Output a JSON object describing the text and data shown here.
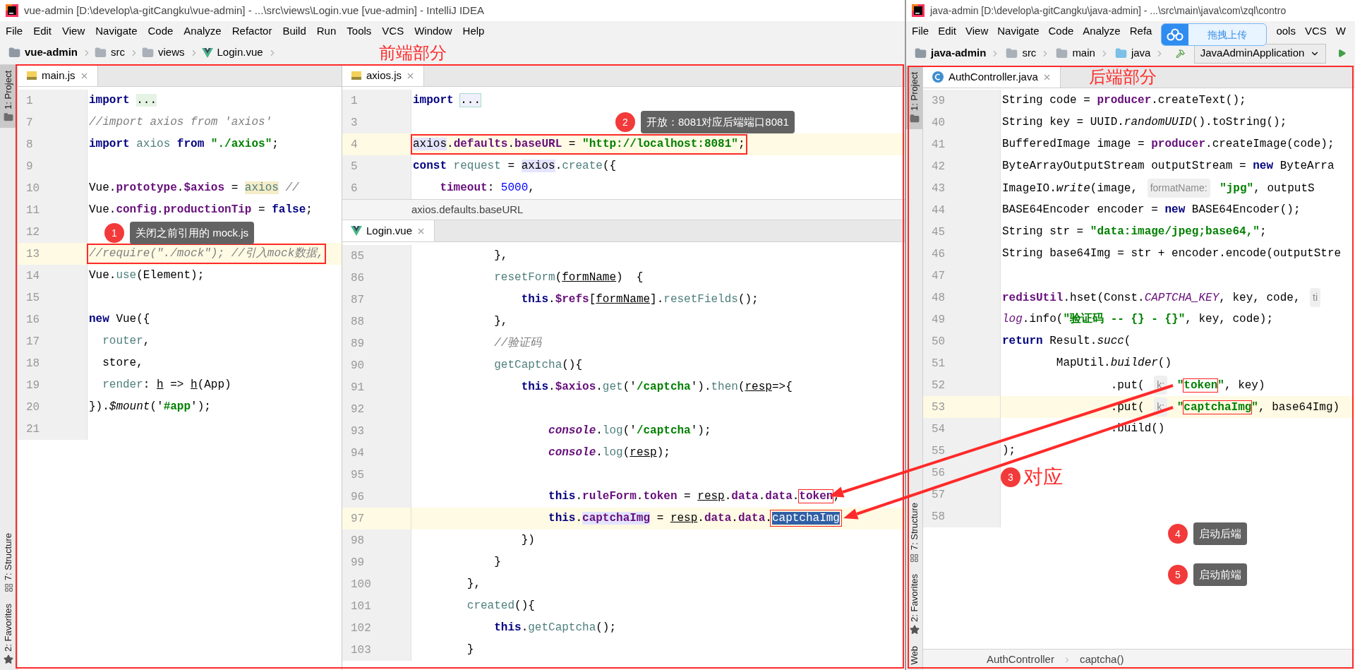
{
  "left_window": {
    "title": "vue-admin [D:\\develop\\a-gitCangku\\vue-admin] - ...\\src\\views\\Login.vue [vue-admin] - IntelliJ IDEA",
    "menu": [
      "File",
      "Edit",
      "View",
      "Navigate",
      "Code",
      "Analyze",
      "Refactor",
      "Build",
      "Run",
      "Tools",
      "VCS",
      "Window",
      "Help"
    ],
    "breadcrumb": [
      {
        "kind": "project",
        "label": "vue-admin"
      },
      {
        "kind": "folder",
        "label": "src"
      },
      {
        "kind": "folder",
        "label": "views"
      },
      {
        "kind": "vue",
        "label": "Login.vue"
      }
    ],
    "annotation_label": "前端部分",
    "tool_strip": [
      {
        "kind": "project",
        "label": "1: Project",
        "selected": true
      },
      {
        "kind": "structure",
        "label": "7: Structure",
        "selected": false
      },
      {
        "kind": "favorites",
        "label": "2: Favorites",
        "selected": false
      }
    ],
    "main_editor": {
      "tab": {
        "kind": "js",
        "label": "main.js"
      },
      "lines": [
        {
          "number": "1",
          "current": false,
          "boxed": false,
          "tokens": [
            {
              "kind": "kw",
              "text": "import "
            },
            {
              "kind": "fold",
              "text": "..."
            }
          ]
        },
        {
          "number": "7",
          "current": false,
          "boxed": false,
          "tokens": [
            {
              "kind": "cmt",
              "text": "//import axios from 'axios'"
            }
          ]
        },
        {
          "number": "8",
          "current": false,
          "boxed": false,
          "tokens": [
            {
              "kind": "kw",
              "text": "import "
            },
            {
              "kind": "fn",
              "text": "axios "
            },
            {
              "kind": "kw",
              "text": "from "
            },
            {
              "kind": "str",
              "text": "\"./axios\""
            },
            {
              "kind": "plain",
              "text": ";"
            }
          ]
        },
        {
          "number": "9",
          "current": false,
          "boxed": false
        },
        {
          "number": "10",
          "current": false,
          "boxed": false,
          "tokens": [
            {
              "kind": "plain",
              "text": "Vue."
            },
            {
              "kind": "fld",
              "text": "prototype"
            },
            {
              "kind": "plain",
              "text": "."
            },
            {
              "kind": "fld",
              "text": "$axios"
            },
            {
              "kind": "plain",
              "text": " = "
            },
            {
              "kind": "fn_mark",
              "text": "axios"
            },
            {
              "kind": "cmt",
              "text": " //"
            }
          ]
        },
        {
          "number": "11",
          "current": false,
          "boxed": false,
          "tokens": [
            {
              "kind": "plain",
              "text": "Vue."
            },
            {
              "kind": "fld",
              "text": "config"
            },
            {
              "kind": "plain",
              "text": "."
            },
            {
              "kind": "fld",
              "text": "productionTip"
            },
            {
              "kind": "plain",
              "text": " = "
            },
            {
              "kind": "kw",
              "text": "false"
            },
            {
              "kind": "plain",
              "text": ";"
            }
          ]
        },
        {
          "number": "12",
          "current": false,
          "boxed": false
        },
        {
          "number": "13",
          "current": true,
          "boxed": true,
          "tokens": [
            {
              "kind": "cmt",
              "text": "//require(\"./mock\"); //引入mock数据,"
            }
          ]
        },
        {
          "number": "14",
          "current": false,
          "boxed": false,
          "tokens": [
            {
              "kind": "plain",
              "text": "Vue."
            },
            {
              "kind": "fn",
              "text": "use"
            },
            {
              "kind": "plain",
              "text": "(Element);"
            }
          ]
        },
        {
          "number": "15",
          "current": false,
          "boxed": false
        },
        {
          "number": "16",
          "current": false,
          "boxed": false,
          "tokens": [
            {
              "kind": "kw",
              "text": "new"
            },
            {
              "kind": "plain",
              "text": " Vue({"
            }
          ]
        },
        {
          "number": "17",
          "current": false,
          "boxed": false,
          "tokens": [
            {
              "kind": "fn",
              "text": "  router"
            },
            {
              "kind": "plain",
              "text": ","
            }
          ]
        },
        {
          "number": "18",
          "current": false,
          "boxed": false,
          "tokens": [
            {
              "kind": "plain",
              "text": "  store,"
            }
          ]
        },
        {
          "number": "19",
          "current": false,
          "boxed": false,
          "tokens": [
            {
              "kind": "fn",
              "text": "  render"
            },
            {
              "kind": "plain",
              "text": ": "
            },
            {
              "kind": "und",
              "text": "h"
            },
            {
              "kind": "plain",
              "text": " => "
            },
            {
              "kind": "und",
              "text": "h"
            },
            {
              "kind": "plain",
              "text": "(App)"
            }
          ]
        },
        {
          "number": "20",
          "current": false,
          "boxed": false,
          "tokens": [
            {
              "kind": "plain",
              "text": "})."
            },
            {
              "kind": "ital",
              "text": "$mount"
            },
            {
              "kind": "plain",
              "text": "('"
            },
            {
              "kind": "str",
              "text": "#app"
            },
            {
              "kind": "plain",
              "text": "');"
            }
          ]
        },
        {
          "number": "21",
          "current": false,
          "boxed": false
        }
      ]
    },
    "axios_editor": {
      "tab": {
        "kind": "js",
        "label": "axios.js"
      },
      "lines": [
        {
          "number": "1",
          "current": false,
          "boxed": false,
          "tokens": [
            {
              "kind": "kw",
              "text": "import "
            },
            {
              "kind": "fold_box",
              "text": "..."
            }
          ]
        },
        {
          "number": "3",
          "current": false,
          "boxed": false
        },
        {
          "number": "4",
          "current": true,
          "boxed": true,
          "tokens": [
            {
              "kind": "plain_hl",
              "text": "axios"
            },
            {
              "kind": "plain",
              "text": "."
            },
            {
              "kind": "fld",
              "text": "defaults"
            },
            {
              "kind": "plain",
              "text": "."
            },
            {
              "kind": "fld",
              "text": "baseURL"
            },
            {
              "kind": "plain",
              "text": " = "
            },
            {
              "kind": "str",
              "text": "\"http://localhost:8081\""
            },
            {
              "kind": "plain",
              "text": ";"
            }
          ]
        },
        {
          "number": "5",
          "current": false,
          "boxed": false,
          "tokens": [
            {
              "kind": "kw",
              "text": "const "
            },
            {
              "kind": "fn",
              "text": "request"
            },
            {
              "kind": "plain",
              "text": " = "
            },
            {
              "kind": "plain_hl",
              "text": "axios"
            },
            {
              "kind": "plain",
              "text": "."
            },
            {
              "kind": "fn",
              "text": "create"
            },
            {
              "kind": "plain",
              "text": "({"
            }
          ]
        },
        {
          "number": "6",
          "current": false,
          "boxed": false,
          "tokens": [
            {
              "kind": "fld",
              "text": "    timeout"
            },
            {
              "kind": "plain",
              "text": ": "
            },
            {
              "kind": "num",
              "text": "5000"
            },
            {
              "kind": "plain",
              "text": ","
            }
          ]
        }
      ],
      "breadcrumb": "axios.defaults.baseURL"
    },
    "login_editor": {
      "tab": {
        "kind": "vue",
        "label": "Login.vue"
      },
      "lines": [
        {
          "number": "85",
          "current": false,
          "boxed": false,
          "tokens": [
            {
              "kind": "plain",
              "text": "            },"
            }
          ]
        },
        {
          "number": "86",
          "current": false,
          "boxed": false,
          "tokens": [
            {
              "kind": "fn",
              "text": "            resetForm"
            },
            {
              "kind": "plain",
              "text": "("
            },
            {
              "kind": "und",
              "text": "formName"
            },
            {
              "kind": "plain",
              "text": ")  {"
            }
          ]
        },
        {
          "number": "87",
          "current": false,
          "boxed": false,
          "tokens": [
            {
              "kind": "kw",
              "text": "                this"
            },
            {
              "kind": "plain",
              "text": "."
            },
            {
              "kind": "fld",
              "text": "$refs"
            },
            {
              "kind": "plain",
              "text": "["
            },
            {
              "kind": "und",
              "text": "formName"
            },
            {
              "kind": "plain",
              "text": "]."
            },
            {
              "kind": "fn",
              "text": "resetFields"
            },
            {
              "kind": "plain",
              "text": "();"
            }
          ]
        },
        {
          "number": "88",
          "current": false,
          "boxed": false,
          "tokens": [
            {
              "kind": "plain",
              "text": "            },"
            }
          ]
        },
        {
          "number": "89",
          "current": false,
          "boxed": false,
          "tokens": [
            {
              "kind": "cmt",
              "text": "            //验证码"
            }
          ]
        },
        {
          "number": "90",
          "current": false,
          "boxed": false,
          "tokens": [
            {
              "kind": "fn",
              "text": "            getCaptcha"
            },
            {
              "kind": "plain",
              "text": "(){"
            }
          ]
        },
        {
          "number": "91",
          "current": false,
          "boxed": false,
          "tokens": [
            {
              "kind": "kw",
              "text": "                this"
            },
            {
              "kind": "plain",
              "text": "."
            },
            {
              "kind": "fld",
              "text": "$axios"
            },
            {
              "kind": "plain",
              "text": "."
            },
            {
              "kind": "fn",
              "text": "get"
            },
            {
              "kind": "plain",
              "text": "('"
            },
            {
              "kind": "str",
              "text": "/captcha"
            },
            {
              "kind": "plain",
              "text": "')."
            },
            {
              "kind": "fn",
              "text": "then"
            },
            {
              "kind": "plain",
              "text": "("
            },
            {
              "kind": "und",
              "text": "resp"
            },
            {
              "kind": "plain",
              "text": "=>{"
            }
          ]
        },
        {
          "number": "92",
          "current": false,
          "boxed": false
        },
        {
          "number": "93",
          "current": false,
          "boxed": false,
          "tokens": [
            {
              "kind": "ital_fld",
              "text": "                    console"
            },
            {
              "kind": "plain",
              "text": "."
            },
            {
              "kind": "fn",
              "text": "log"
            },
            {
              "kind": "plain",
              "text": "('"
            },
            {
              "kind": "str",
              "text": "/captcha"
            },
            {
              "kind": "plain",
              "text": "');"
            }
          ]
        },
        {
          "number": "94",
          "current": false,
          "boxed": false,
          "tokens": [
            {
              "kind": "ital_fld",
              "text": "                    console"
            },
            {
              "kind": "plain",
              "text": "."
            },
            {
              "kind": "fn",
              "text": "log"
            },
            {
              "kind": "plain",
              "text": "("
            },
            {
              "kind": "und",
              "text": "resp"
            },
            {
              "kind": "plain",
              "text": ");"
            }
          ]
        },
        {
          "number": "95",
          "current": false,
          "boxed": false
        },
        {
          "number": "96",
          "current": false,
          "boxed": false,
          "tokens": [
            {
              "kind": "kw",
              "text": "                    this"
            },
            {
              "kind": "plain",
              "text": "."
            },
            {
              "kind": "fld",
              "text": "ruleForm"
            },
            {
              "kind": "plain",
              "text": "."
            },
            {
              "kind": "fld",
              "text": "token"
            },
            {
              "kind": "plain",
              "text": " = "
            },
            {
              "kind": "und",
              "text": "resp"
            },
            {
              "kind": "plain",
              "text": "."
            },
            {
              "kind": "fld",
              "text": "data"
            },
            {
              "kind": "plain",
              "text": "."
            },
            {
              "kind": "fld",
              "text": "data"
            },
            {
              "kind": "plain",
              "text": "."
            },
            {
              "kind": "fld_box",
              "text": "token"
            },
            {
              "kind": "plain",
              "text": ";"
            }
          ]
        },
        {
          "number": "97",
          "current": true,
          "boxed": false,
          "tokens": [
            {
              "kind": "kw",
              "text": "                    this"
            },
            {
              "kind": "plain",
              "text": "."
            },
            {
              "kind": "fld_hl",
              "text": "captchaImg"
            },
            {
              "kind": "plain",
              "text": " = "
            },
            {
              "kind": "und",
              "text": "resp"
            },
            {
              "kind": "plain",
              "text": "."
            },
            {
              "kind": "fld",
              "text": "data"
            },
            {
              "kind": "plain",
              "text": "."
            },
            {
              "kind": "fld",
              "text": "data"
            },
            {
              "kind": "plain",
              "text": "."
            },
            {
              "kind": "sel_box",
              "text": "captchaImg"
            }
          ]
        },
        {
          "number": "98",
          "current": false,
          "boxed": false,
          "tokens": [
            {
              "kind": "plain",
              "text": "                })"
            }
          ]
        },
        {
          "number": "99",
          "current": false,
          "boxed": false,
          "tokens": [
            {
              "kind": "plain",
              "text": "            }"
            }
          ]
        },
        {
          "number": "100",
          "current": false,
          "boxed": false,
          "tokens": [
            {
              "kind": "plain",
              "text": "        },"
            }
          ]
        },
        {
          "number": "101",
          "current": false,
          "boxed": false,
          "tokens": [
            {
              "kind": "fn",
              "text": "        created"
            },
            {
              "kind": "plain",
              "text": "(){"
            }
          ]
        },
        {
          "number": "102",
          "current": false,
          "boxed": false,
          "tokens": [
            {
              "kind": "kw",
              "text": "            this"
            },
            {
              "kind": "plain",
              "text": "."
            },
            {
              "kind": "fn",
              "text": "getCaptcha"
            },
            {
              "kind": "plain",
              "text": "();"
            }
          ]
        },
        {
          "number": "103",
          "current": false,
          "boxed": false,
          "tokens": [
            {
              "kind": "plain",
              "text": "        }"
            }
          ]
        }
      ]
    }
  },
  "right_window": {
    "title": "java-admin [D:\\develop\\a-gitCangku\\java-admin] - ...\\src\\main\\java\\com\\zql\\contro",
    "menu": [
      "File",
      "Edit",
      "View",
      "Navigate",
      "Code",
      "Analyze",
      "Refa"
    ],
    "upload_widget": "拖拽上传",
    "menu_after": [
      "ools",
      "VCS",
      "W"
    ],
    "breadcrumb": [
      {
        "kind": "project",
        "label": "java-admin"
      },
      {
        "kind": "folder",
        "label": "src"
      },
      {
        "kind": "folder",
        "label": "main"
      },
      {
        "kind": "source",
        "label": "java"
      }
    ],
    "run_config": "JavaAdminApplication",
    "tool_strip": [
      {
        "kind": "project",
        "label": "1: Project",
        "selected": true
      },
      {
        "kind": "structure",
        "label": "7: Structure",
        "selected": false
      },
      {
        "kind": "favorites",
        "label": "2: Favorites",
        "selected": false
      },
      {
        "kind": "web",
        "label": "Web",
        "selected": false
      }
    ],
    "editor": {
      "tab": {
        "kind": "java",
        "label": "AuthController.java"
      },
      "lines": [
        {
          "number": "39",
          "current": false,
          "boxed": false,
          "tokens": [
            {
              "kind": "plain",
              "text": "String code = "
            },
            {
              "kind": "fld",
              "text": "producer"
            },
            {
              "kind": "plain",
              "text": ".createText();"
            }
          ]
        },
        {
          "number": "40",
          "current": false,
          "boxed": false,
          "tokens": [
            {
              "kind": "plain",
              "text": "String key = UUID."
            },
            {
              "kind": "ital",
              "text": "randomUUID"
            },
            {
              "kind": "plain",
              "text": "().toString();"
            }
          ]
        },
        {
          "number": "41",
          "current": false,
          "boxed": false,
          "tokens": [
            {
              "kind": "plain",
              "text": "BufferedImage image = "
            },
            {
              "kind": "fld",
              "text": "producer"
            },
            {
              "kind": "plain",
              "text": ".createImage(code);"
            }
          ]
        },
        {
          "number": "42",
          "current": false,
          "boxed": false,
          "tokens": [
            {
              "kind": "plain",
              "text": "ByteArrayOutputStream outputStream = "
            },
            {
              "kind": "kw",
              "text": "new"
            },
            {
              "kind": "plain",
              "text": " ByteArra"
            }
          ]
        },
        {
          "number": "43",
          "current": false,
          "boxed": false,
          "tokens": [
            {
              "kind": "plain",
              "text": "ImageIO."
            },
            {
              "kind": "ital",
              "text": "write"
            },
            {
              "kind": "plain",
              "text": "(image, "
            },
            {
              "kind": "hint",
              "text": "formatName:"
            },
            {
              "kind": "str",
              "text": " \"jpg\""
            },
            {
              "kind": "plain",
              "text": ", outputS"
            }
          ]
        },
        {
          "number": "44",
          "current": false,
          "boxed": false,
          "tokens": [
            {
              "kind": "plain",
              "text": "BASE64Encoder encoder = "
            },
            {
              "kind": "kw",
              "text": "new"
            },
            {
              "kind": "plain",
              "text": " BASE64Encoder();"
            }
          ]
        },
        {
          "number": "45",
          "current": false,
          "boxed": false,
          "tokens": [
            {
              "kind": "plain",
              "text": "String str = "
            },
            {
              "kind": "str",
              "text": "\"data:image/jpeg;base64,\""
            },
            {
              "kind": "plain",
              "text": ";"
            }
          ]
        },
        {
          "number": "46",
          "current": false,
          "boxed": false,
          "tokens": [
            {
              "kind": "plain",
              "text": "String base64Img = str + encoder.encode(outputStre"
            }
          ]
        },
        {
          "number": "47",
          "current": false,
          "boxed": false
        },
        {
          "number": "48",
          "current": false,
          "boxed": false,
          "tokens": [
            {
              "kind": "fld",
              "text": "redisUtil"
            },
            {
              "kind": "plain",
              "text": ".hset(Const."
            },
            {
              "kind": "static",
              "text": "CAPTCHA_KEY"
            },
            {
              "kind": "plain",
              "text": ", key, code, "
            },
            {
              "kind": "hint",
              "text": "ti"
            }
          ]
        },
        {
          "number": "49",
          "current": false,
          "boxed": false,
          "tokens": [
            {
              "kind": "static",
              "text": "log"
            },
            {
              "kind": "plain",
              "text": ".info("
            },
            {
              "kind": "str",
              "text": "\"验证码 -- {} - {}\""
            },
            {
              "kind": "plain",
              "text": ", key, code);"
            }
          ]
        },
        {
          "number": "50",
          "current": false,
          "boxed": false,
          "tokens": [
            {
              "kind": "kw",
              "text": "return"
            },
            {
              "kind": "plain",
              "text": " Result."
            },
            {
              "kind": "ital",
              "text": "succ"
            },
            {
              "kind": "plain",
              "text": "("
            }
          ]
        },
        {
          "number": "51",
          "current": false,
          "boxed": false,
          "tokens": [
            {
              "kind": "plain",
              "text": "        MapUtil."
            },
            {
              "kind": "ital",
              "text": "builder"
            },
            {
              "kind": "plain",
              "text": "()"
            }
          ]
        },
        {
          "number": "52",
          "current": false,
          "boxed": false,
          "tokens": [
            {
              "kind": "plain",
              "text": "                .put( "
            },
            {
              "kind": "hint",
              "text": "k:"
            },
            {
              "kind": "str",
              "text": " \""
            },
            {
              "kind": "str_box",
              "text": "token"
            },
            {
              "kind": "str",
              "text": "\""
            },
            {
              "kind": "plain",
              "text": ", key)"
            }
          ]
        },
        {
          "number": "53",
          "current": true,
          "boxed": false,
          "tokens": [
            {
              "kind": "plain",
              "text": "                .put( "
            },
            {
              "kind": "hint",
              "text": "k:"
            },
            {
              "kind": "str",
              "text": " \""
            },
            {
              "kind": "str_box",
              "text": "captchaImg"
            },
            {
              "kind": "str",
              "text": "\""
            },
            {
              "kind": "plain",
              "text": ", base64Img)"
            }
          ]
        },
        {
          "number": "54",
          "current": false,
          "boxed": false,
          "tokens": [
            {
              "kind": "plain",
              "text": "                .build()"
            }
          ]
        },
        {
          "number": "55",
          "current": false,
          "boxed": false,
          "tokens": [
            {
              "kind": "plain",
              "text": ");"
            }
          ]
        },
        {
          "number": "56",
          "current": false,
          "boxed": false
        },
        {
          "number": "57",
          "current": false,
          "boxed": false
        },
        {
          "number": "58",
          "current": false,
          "boxed": false
        }
      ],
      "breadcrumb": [
        "AuthController",
        "captcha()"
      ]
    },
    "annotation_label": "后端部分"
  },
  "callouts": [
    {
      "kind": "tooltip",
      "number": "1",
      "text": "关闭之前引用的 mock.js"
    },
    {
      "kind": "tooltip",
      "number": "2",
      "text": "开放：8081对应后端端口8081"
    },
    {
      "kind": "label",
      "number": "3",
      "text": "对应"
    },
    {
      "kind": "tooltip",
      "number": "4",
      "text": "启动后端"
    },
    {
      "kind": "tooltip",
      "number": "5",
      "text": "启动前端"
    }
  ]
}
